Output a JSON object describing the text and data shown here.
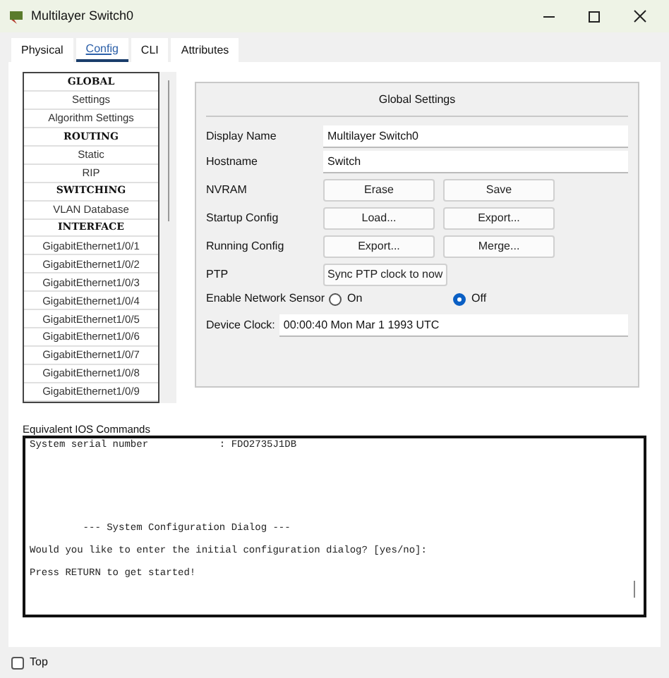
{
  "window": {
    "title": "Multilayer Switch0"
  },
  "tabs": [
    {
      "label": "Physical",
      "selected": false
    },
    {
      "label": "Config",
      "selected": true
    },
    {
      "label": "CLI",
      "selected": false
    },
    {
      "label": "Attributes",
      "selected": false
    }
  ],
  "sidebar": {
    "items": [
      {
        "label": "GLOBAL",
        "kind": "header"
      },
      {
        "label": "Settings",
        "kind": "item"
      },
      {
        "label": "Algorithm Settings",
        "kind": "item"
      },
      {
        "label": "ROUTING",
        "kind": "header"
      },
      {
        "label": "Static",
        "kind": "item"
      },
      {
        "label": "RIP",
        "kind": "item"
      },
      {
        "label": "SWITCHING",
        "kind": "header"
      },
      {
        "label": "VLAN Database",
        "kind": "item"
      },
      {
        "label": "INTERFACE",
        "kind": "header"
      },
      {
        "label": "GigabitEthernet1/0/1",
        "kind": "item"
      },
      {
        "label": "GigabitEthernet1/0/2",
        "kind": "item"
      },
      {
        "label": "GigabitEthernet1/0/3",
        "kind": "item"
      },
      {
        "label": "GigabitEthernet1/0/4",
        "kind": "item"
      },
      {
        "label": "GigabitEthernet1/0/5",
        "kind": "item"
      },
      {
        "label": "GigabitEthernet1/0/6",
        "kind": "item"
      },
      {
        "label": "GigabitEthernet1/0/7",
        "kind": "item"
      },
      {
        "label": "GigabitEthernet1/0/8",
        "kind": "item"
      },
      {
        "label": "GigabitEthernet1/0/9",
        "kind": "item"
      }
    ]
  },
  "global_settings": {
    "title": "Global Settings",
    "display_name": {
      "label": "Display Name",
      "value": "Multilayer Switch0"
    },
    "hostname": {
      "label": "Hostname",
      "value": "Switch"
    },
    "button_rows": [
      {
        "label": "NVRAM",
        "buttons": [
          "Erase",
          "Save"
        ]
      },
      {
        "label": "Startup Config",
        "buttons": [
          "Load...",
          "Export..."
        ]
      },
      {
        "label": "Running Config",
        "buttons": [
          "Export...",
          "Merge..."
        ]
      },
      {
        "label": "PTP",
        "buttons": [
          "Sync PTP clock to now"
        ]
      }
    ],
    "network_sensor": {
      "label": "Enable Network Sensor",
      "options": [
        {
          "label": "On",
          "selected": false
        },
        {
          "label": "Off",
          "selected": true
        }
      ]
    },
    "device_clock": {
      "label": "Device Clock:",
      "value": "00:00:40 Mon Mar 1 1993 UTC"
    }
  },
  "ios_commands": {
    "label": "Equivalent IOS Commands",
    "lines": [
      {
        "text": "System serial number            : FDO2735J1DB",
        "kind": "line"
      },
      {
        "text": "         --- System Configuration Dialog ---",
        "kind": "section"
      },
      {
        "text": "Would you like to enter the initial configuration dialog? [yes/no]:",
        "kind": "paragraph"
      },
      {
        "text": "Press RETURN to get started!",
        "kind": "paragraph"
      }
    ]
  },
  "top_checkbox": {
    "label": "Top",
    "checked": false
  }
}
